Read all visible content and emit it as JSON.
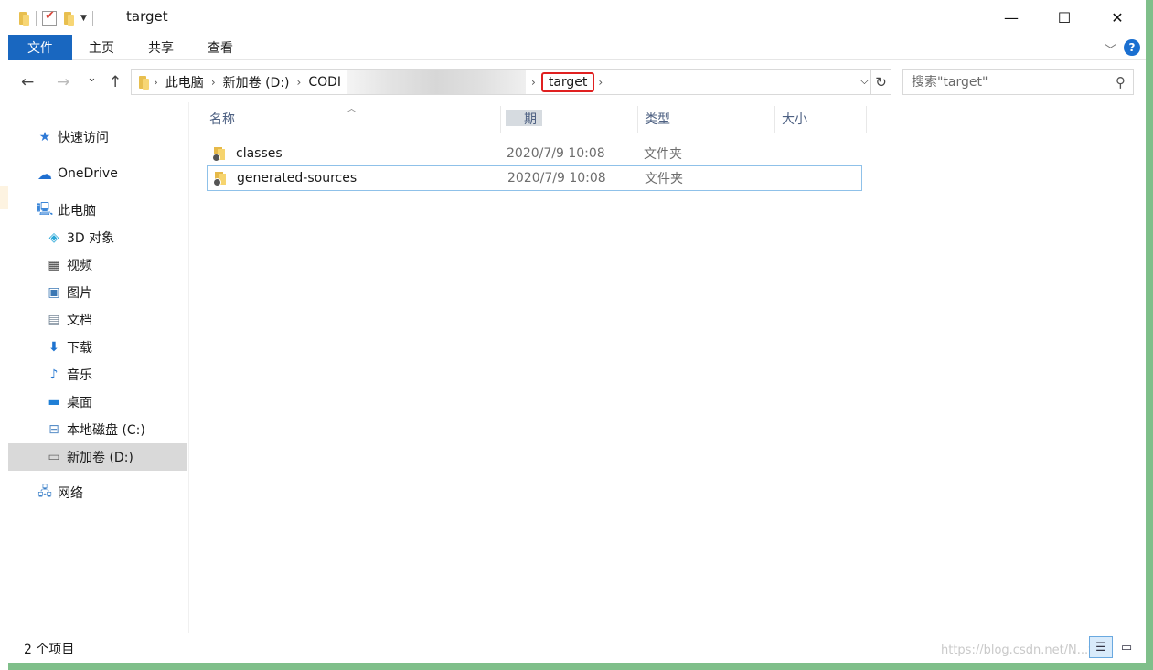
{
  "window": {
    "title": "target",
    "min_label": "—",
    "max_label": "☐",
    "close_label": "✕"
  },
  "ribbon": {
    "tabs": [
      "文件",
      "主页",
      "共享",
      "查看"
    ],
    "expand_label": "﹀",
    "help_label": "?"
  },
  "nav": {
    "back_label": "←",
    "forward_label": "→",
    "recent_label": "⌄",
    "up_label": "↑",
    "breadcrumbs": [
      "此电脑",
      "新加卷 (D:)",
      "CODI"
    ],
    "current": "target",
    "refresh_label": "↻",
    "search_placeholder": "搜索\"target\""
  },
  "sidebar": {
    "items": [
      {
        "label": "快速访问",
        "icon": "star-icon"
      },
      {
        "label": "OneDrive",
        "icon": "cloud-icon"
      },
      {
        "label": "此电脑",
        "icon": "computer-icon"
      },
      {
        "label": "3D 对象",
        "icon": "cube-icon"
      },
      {
        "label": "视频",
        "icon": "film-icon"
      },
      {
        "label": "图片",
        "icon": "picture-icon"
      },
      {
        "label": "文档",
        "icon": "document-icon"
      },
      {
        "label": "下载",
        "icon": "download-icon"
      },
      {
        "label": "音乐",
        "icon": "music-icon"
      },
      {
        "label": "桌面",
        "icon": "desktop-icon"
      },
      {
        "label": "本地磁盘 (C:)",
        "icon": "disk-icon"
      },
      {
        "label": "新加卷 (D:)",
        "icon": "drive-icon"
      },
      {
        "label": "网络",
        "icon": "network-icon"
      }
    ]
  },
  "columns": {
    "name": "名称",
    "date": "期",
    "type": "类型",
    "size": "大小"
  },
  "files": [
    {
      "name": "classes",
      "date": "2020/7/9 10:08",
      "type": "文件夹"
    },
    {
      "name": "generated-sources",
      "date": "2020/7/9 10:08",
      "type": "文件夹"
    }
  ],
  "status": {
    "count": "2 个项目",
    "watermark": "https://blog.csdn.net/N...y"
  },
  "colors": {
    "accent": "#1967c0",
    "highlight_border": "#e02020",
    "selection_border": "#8fc1e9"
  }
}
